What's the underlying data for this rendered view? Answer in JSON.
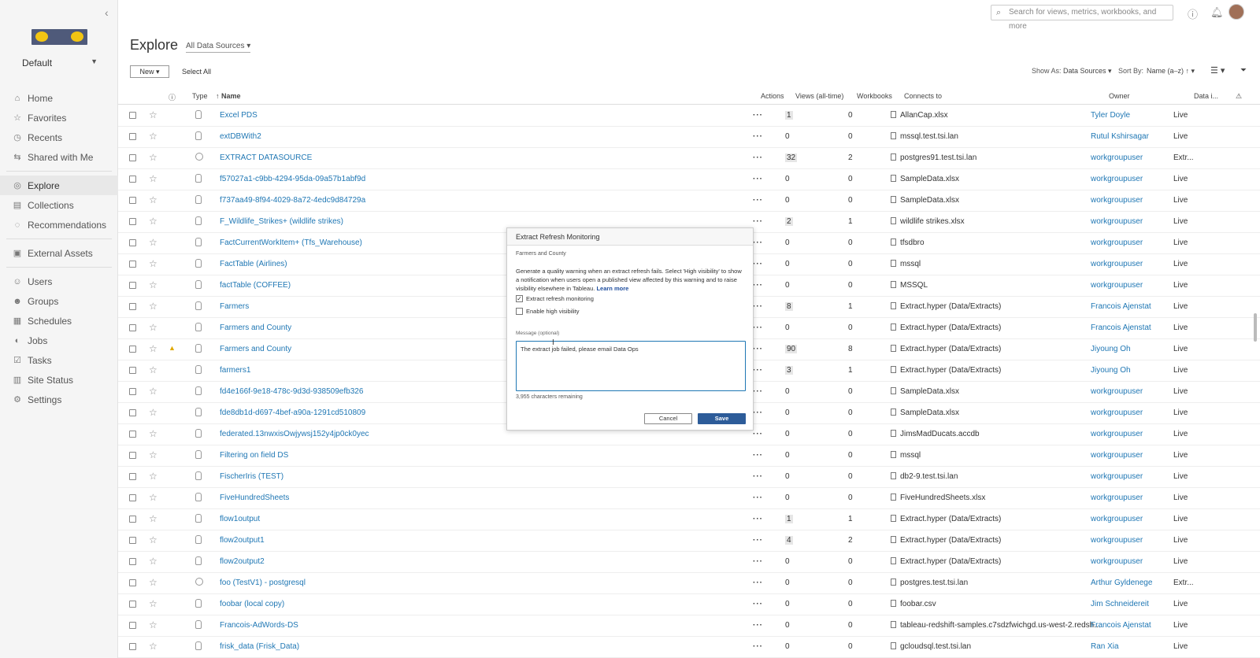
{
  "sidebar": {
    "site_name": "Default",
    "nav_group1": [
      {
        "label": "Home",
        "icon": "⌂",
        "active": false
      },
      {
        "label": "Favorites",
        "icon": "☆",
        "active": false
      },
      {
        "label": "Recents",
        "icon": "◷",
        "active": false
      },
      {
        "label": "Shared with Me",
        "icon": "⇆",
        "active": false
      }
    ],
    "nav_group2": [
      {
        "label": "Explore",
        "icon": "◎",
        "active": true
      },
      {
        "label": "Collections",
        "icon": "▤",
        "active": false
      },
      {
        "label": "Recommendations",
        "icon": "◌",
        "active": false
      }
    ],
    "nav_group3": [
      {
        "label": "External Assets",
        "icon": "▣",
        "active": false
      }
    ],
    "nav_group4": [
      {
        "label": "Users",
        "icon": "☺",
        "active": false
      },
      {
        "label": "Groups",
        "icon": "☻",
        "active": false
      },
      {
        "label": "Schedules",
        "icon": "▦",
        "active": false
      },
      {
        "label": "Jobs",
        "icon": "◐",
        "active": false
      },
      {
        "label": "Tasks",
        "icon": "☑",
        "active": false
      },
      {
        "label": "Site Status",
        "icon": "▥",
        "active": false
      },
      {
        "label": "Settings",
        "icon": "⚙",
        "active": false
      }
    ]
  },
  "topbar": {
    "search_placeholder": "Search for views, metrics, workbooks, and more"
  },
  "header": {
    "title": "Explore",
    "source_filter": "All Data Sources",
    "new_label": "New",
    "select_all_label": "Select All",
    "show_as_label": "Show As:",
    "show_as_value": "Data Sources",
    "sort_by_label": "Sort By:",
    "sort_by_value": "Name (a–z) ↑"
  },
  "table": {
    "columns": {
      "type": "Type",
      "name": "↑ Name",
      "actions": "Actions",
      "views": "Views (all-time)",
      "workbooks": "Workbooks",
      "connects_to": "Connects to",
      "owner": "Owner",
      "data": "Data i..."
    },
    "rows": [
      {
        "name": "Excel PDS",
        "type": "single",
        "warn": false,
        "views": "1",
        "views_bar": true,
        "workbooks": "0",
        "connects": "AllanCap.xlsx",
        "owner": "Tyler Doyle",
        "data": "Live"
      },
      {
        "name": "extDBWith2",
        "type": "single",
        "warn": false,
        "views": "0",
        "views_bar": false,
        "workbooks": "0",
        "connects": "mssql.test.tsi.lan",
        "owner": "Rutul Kshirsagar",
        "data": "Live"
      },
      {
        "name": "EXTRACT DATASOURCE",
        "type": "multi",
        "warn": false,
        "views": "32",
        "views_bar": true,
        "workbooks": "2",
        "connects": "postgres91.test.tsi.lan",
        "owner": "workgroupuser",
        "data": "Extr..."
      },
      {
        "name": "f57027a1-c9bb-4294-95da-09a57b1abf9d",
        "type": "single",
        "warn": false,
        "views": "0",
        "views_bar": false,
        "workbooks": "0",
        "connects": "SampleData.xlsx",
        "owner": "workgroupuser",
        "data": "Live"
      },
      {
        "name": "f737aa49-8f94-4029-8a72-4edc9d84729a",
        "type": "single",
        "warn": false,
        "views": "0",
        "views_bar": false,
        "workbooks": "0",
        "connects": "SampleData.xlsx",
        "owner": "workgroupuser",
        "data": "Live"
      },
      {
        "name": "F_Wildlife_Strikes+ (wildlife strikes)",
        "type": "single",
        "warn": false,
        "views": "2",
        "views_bar": true,
        "workbooks": "1",
        "connects": "wildlife strikes.xlsx",
        "owner": "workgroupuser",
        "data": "Live"
      },
      {
        "name": "FactCurrentWorkItem+ (Tfs_Warehouse)",
        "type": "single",
        "warn": false,
        "views": "0",
        "views_bar": false,
        "workbooks": "0",
        "connects": "tfsdbro",
        "owner": "workgroupuser",
        "data": "Live"
      },
      {
        "name": "FactTable (Airlines)",
        "type": "single",
        "warn": false,
        "views": "0",
        "views_bar": false,
        "workbooks": "0",
        "connects": "mssql",
        "owner": "workgroupuser",
        "data": "Live"
      },
      {
        "name": "factTable (COFFEE)",
        "type": "single",
        "warn": false,
        "views": "0",
        "views_bar": false,
        "workbooks": "0",
        "connects": "MSSQL",
        "owner": "workgroupuser",
        "data": "Live"
      },
      {
        "name": "Farmers",
        "type": "single",
        "warn": false,
        "views": "8",
        "views_bar": true,
        "workbooks": "1",
        "connects": "Extract.hyper (Data/Extracts)",
        "owner": "Francois Ajenstat",
        "data": "Live"
      },
      {
        "name": "Farmers and County",
        "type": "single",
        "warn": false,
        "views": "0",
        "views_bar": false,
        "workbooks": "0",
        "connects": "Extract.hyper (Data/Extracts)",
        "owner": "Francois Ajenstat",
        "data": "Live"
      },
      {
        "name": "Farmers and County",
        "type": "single",
        "warn": true,
        "views": "90",
        "views_bar": true,
        "workbooks": "8",
        "connects": "Extract.hyper (Data/Extracts)",
        "owner": "Jiyoung Oh",
        "data": "Live"
      },
      {
        "name": "farmers1",
        "type": "single",
        "warn": false,
        "views": "3",
        "views_bar": true,
        "workbooks": "1",
        "connects": "Extract.hyper (Data/Extracts)",
        "owner": "Jiyoung Oh",
        "data": "Live"
      },
      {
        "name": "fd4e166f-9e18-478c-9d3d-938509efb326",
        "type": "single",
        "warn": false,
        "views": "0",
        "views_bar": false,
        "workbooks": "0",
        "connects": "SampleData.xlsx",
        "owner": "workgroupuser",
        "data": "Live"
      },
      {
        "name": "fde8db1d-d697-4bef-a90a-1291cd510809",
        "type": "single",
        "warn": false,
        "views": "0",
        "views_bar": false,
        "workbooks": "0",
        "connects": "SampleData.xlsx",
        "owner": "workgroupuser",
        "data": "Live"
      },
      {
        "name": "federated.13nwxisOwjywsj152y4jp0ck0yec",
        "type": "single",
        "warn": false,
        "views": "0",
        "views_bar": false,
        "workbooks": "0",
        "connects": "JimsMadDucats.accdb",
        "owner": "workgroupuser",
        "data": "Live"
      },
      {
        "name": "Filtering on field DS",
        "type": "single",
        "warn": false,
        "views": "0",
        "views_bar": false,
        "workbooks": "0",
        "connects": "mssql",
        "owner": "workgroupuser",
        "data": "Live"
      },
      {
        "name": "FischerIris (TEST)",
        "type": "single",
        "warn": false,
        "views": "0",
        "views_bar": false,
        "workbooks": "0",
        "connects": "db2-9.test.tsi.lan",
        "owner": "workgroupuser",
        "data": "Live"
      },
      {
        "name": "FiveHundredSheets",
        "type": "single",
        "warn": false,
        "views": "0",
        "views_bar": false,
        "workbooks": "0",
        "connects": "FiveHundredSheets.xlsx",
        "owner": "workgroupuser",
        "data": "Live"
      },
      {
        "name": "flow1output",
        "type": "single",
        "warn": false,
        "views": "1",
        "views_bar": true,
        "workbooks": "1",
        "connects": "Extract.hyper (Data/Extracts)",
        "owner": "workgroupuser",
        "data": "Live"
      },
      {
        "name": "flow2output1",
        "type": "single",
        "warn": false,
        "views": "4",
        "views_bar": true,
        "workbooks": "2",
        "connects": "Extract.hyper (Data/Extracts)",
        "owner": "workgroupuser",
        "data": "Live"
      },
      {
        "name": "flow2output2",
        "type": "single",
        "warn": false,
        "views": "0",
        "views_bar": false,
        "workbooks": "0",
        "connects": "Extract.hyper (Data/Extracts)",
        "owner": "workgroupuser",
        "data": "Live"
      },
      {
        "name": "foo (TestV1) - postgresql",
        "type": "multi",
        "warn": false,
        "views": "0",
        "views_bar": false,
        "workbooks": "0",
        "connects": "postgres.test.tsi.lan",
        "owner": "Arthur Gyldenege",
        "data": "Extr..."
      },
      {
        "name": "foobar (local copy)",
        "type": "single",
        "warn": false,
        "views": "0",
        "views_bar": false,
        "workbooks": "0",
        "connects": "foobar.csv",
        "owner": "Jim Schneidereit",
        "data": "Live"
      },
      {
        "name": "Francois-AdWords-DS",
        "type": "single",
        "warn": false,
        "views": "0",
        "views_bar": false,
        "workbooks": "0",
        "connects": "tableau-redshift-samples.c7sdzfwichgd.us-west-2.redsh...",
        "owner": "Francois Ajenstat",
        "data": "Live"
      },
      {
        "name": "frisk_data (Frisk_Data)",
        "type": "single",
        "warn": false,
        "views": "0",
        "views_bar": false,
        "workbooks": "0",
        "connects": "gcloudsql.test.tsi.lan",
        "owner": "Ran Xia",
        "data": "Live"
      }
    ]
  },
  "dialog": {
    "title": "Extract Refresh Monitoring",
    "subtitle": "Farmers and County",
    "description": "Generate a quality warning when an extract refresh fails. Select 'High visibility' to show a notification when users open a published view affected by this warning and to raise visibility elsewhere in Tableau.",
    "learn_more": "Learn more",
    "check1_label": "Extract refresh monitoring",
    "check1_checked": true,
    "check2_label": "Enable high visibility",
    "check2_checked": false,
    "message_label": "Message (optional)",
    "message_value": "The extract job failed, please email Data Ops",
    "remaining": "3,955 characters remaining",
    "cancel_label": "Cancel",
    "save_label": "Save"
  }
}
